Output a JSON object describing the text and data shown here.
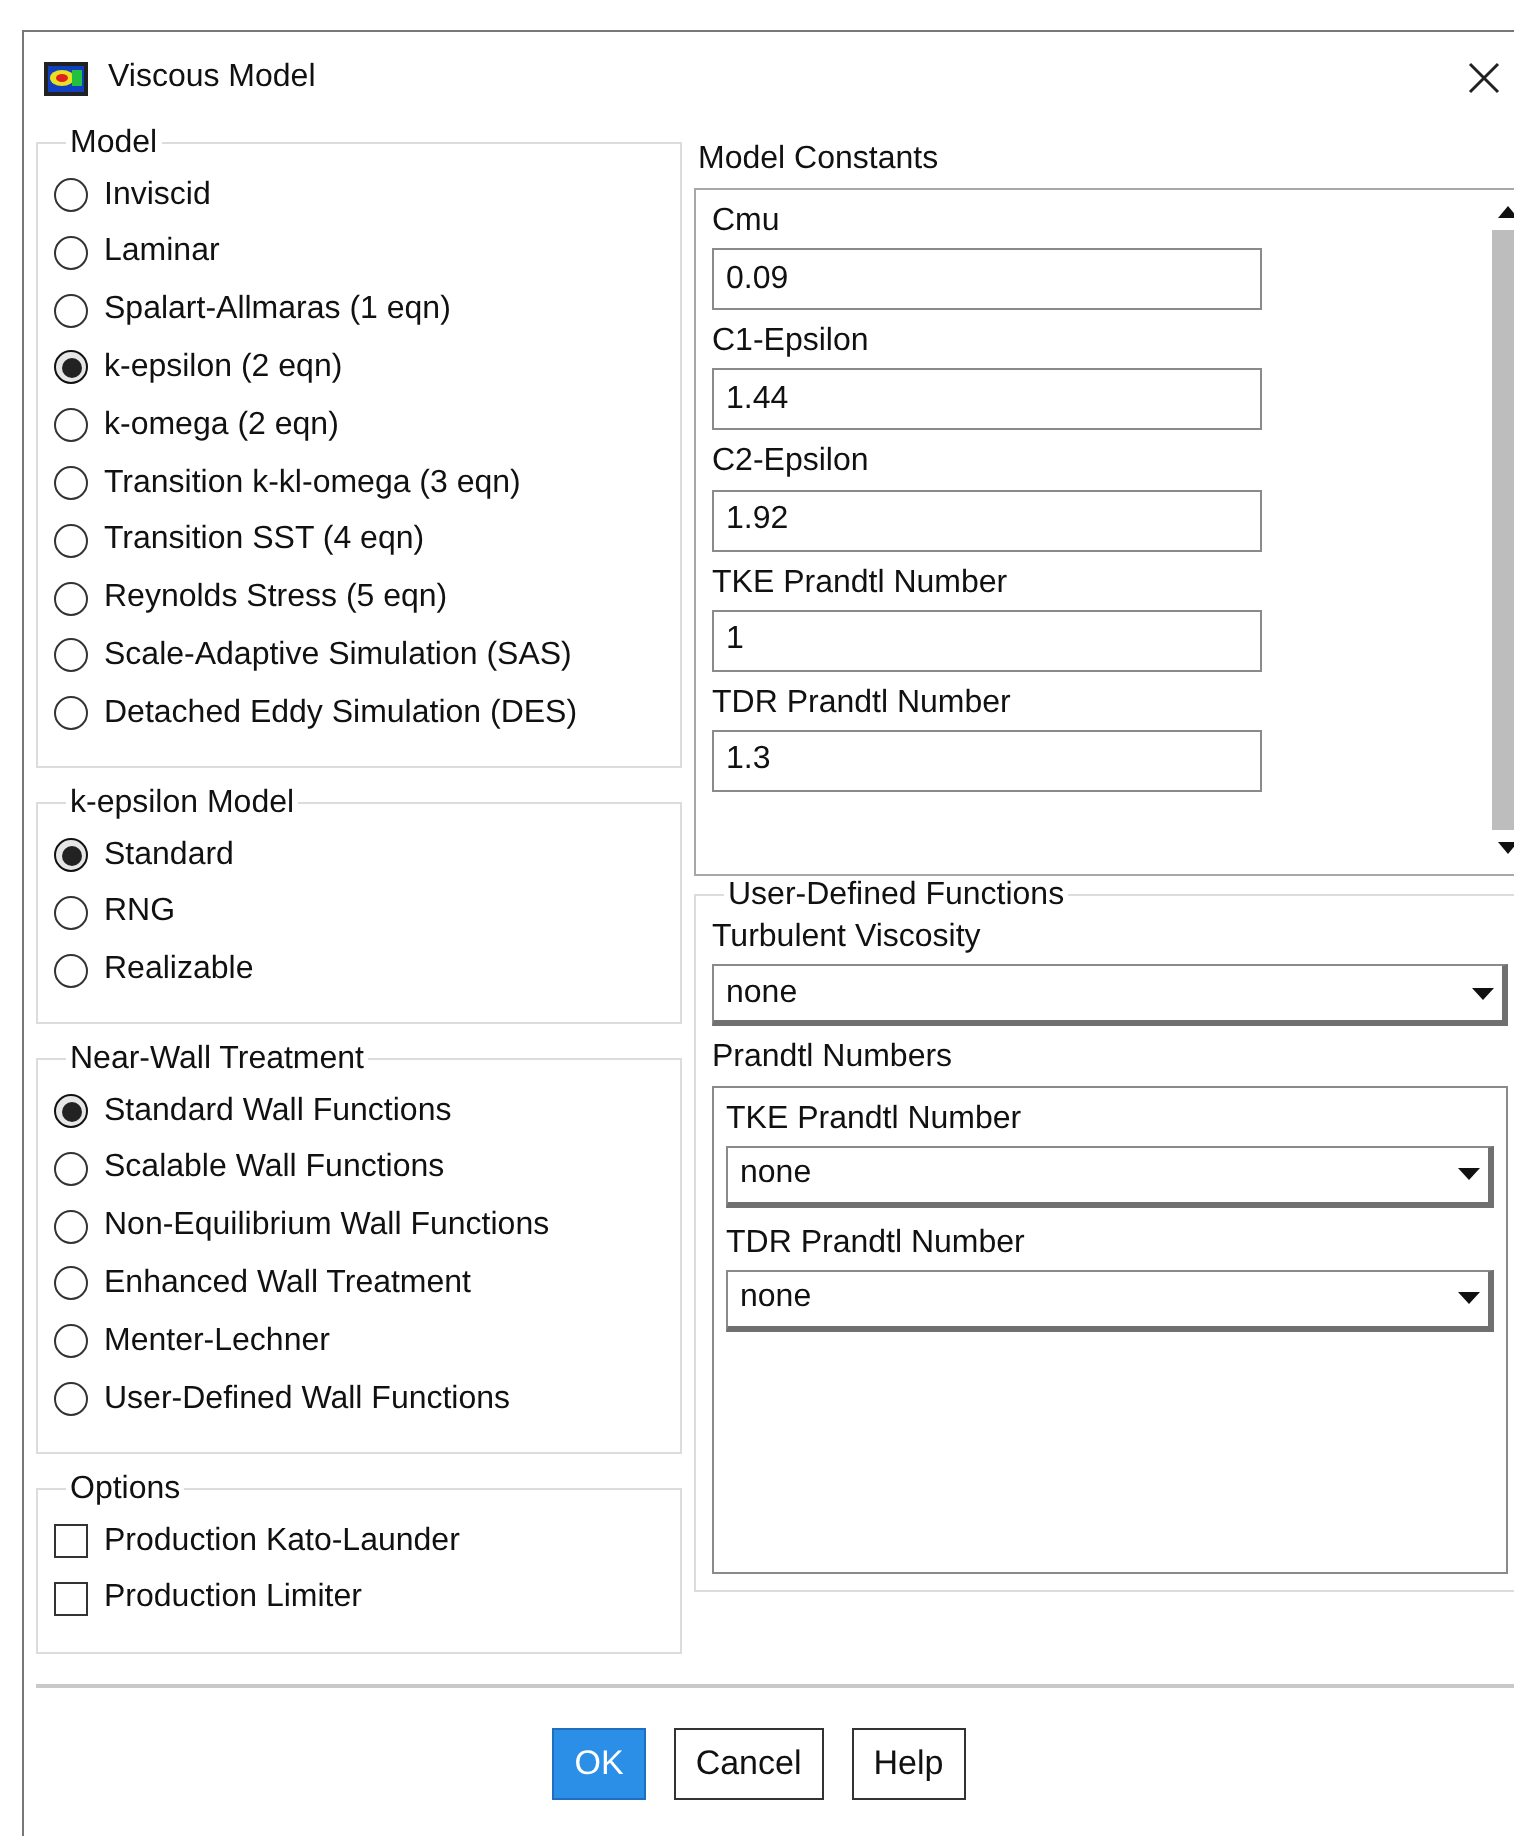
{
  "window": {
    "title": "Viscous Model"
  },
  "model": {
    "title": "Model",
    "options": [
      {
        "label": "Inviscid",
        "selected": false
      },
      {
        "label": "Laminar",
        "selected": false
      },
      {
        "label": "Spalart-Allmaras (1 eqn)",
        "selected": false
      },
      {
        "label": "k-epsilon (2 eqn)",
        "selected": true
      },
      {
        "label": "k-omega (2 eqn)",
        "selected": false
      },
      {
        "label": "Transition k-kl-omega (3 eqn)",
        "selected": false
      },
      {
        "label": "Transition SST (4 eqn)",
        "selected": false
      },
      {
        "label": "Reynolds Stress (5 eqn)",
        "selected": false
      },
      {
        "label": "Scale-Adaptive Simulation (SAS)",
        "selected": false
      },
      {
        "label": "Detached Eddy Simulation (DES)",
        "selected": false
      }
    ]
  },
  "k_epsilon_model": {
    "title": "k-epsilon Model",
    "options": [
      {
        "label": "Standard",
        "selected": true
      },
      {
        "label": "RNG",
        "selected": false
      },
      {
        "label": "Realizable",
        "selected": false
      }
    ]
  },
  "near_wall_treatment": {
    "title": "Near-Wall Treatment",
    "options": [
      {
        "label": "Standard Wall Functions",
        "selected": true
      },
      {
        "label": "Scalable Wall Functions",
        "selected": false
      },
      {
        "label": "Non-Equilibrium Wall Functions",
        "selected": false
      },
      {
        "label": "Enhanced Wall Treatment",
        "selected": false
      },
      {
        "label": "Menter-Lechner",
        "selected": false
      },
      {
        "label": "User-Defined Wall Functions",
        "selected": false
      }
    ]
  },
  "options": {
    "title": "Options",
    "items": [
      {
        "label": "Production Kato-Launder",
        "checked": false
      },
      {
        "label": "Production Limiter",
        "checked": false
      }
    ]
  },
  "model_constants": {
    "title": "Model Constants",
    "fields": [
      {
        "label": "Cmu",
        "value": "0.09"
      },
      {
        "label": "C1-Epsilon",
        "value": "1.44"
      },
      {
        "label": "C2-Epsilon",
        "value": "1.92"
      },
      {
        "label": "TKE Prandtl Number",
        "value": "1"
      },
      {
        "label": "TDR Prandtl Number",
        "value": "1.3"
      }
    ]
  },
  "user_defined_functions": {
    "title": "User-Defined Functions",
    "turbulent_viscosity": {
      "label": "Turbulent Viscosity",
      "value": "none"
    },
    "prandtl_numbers": {
      "title": "Prandtl Numbers",
      "fields": [
        {
          "label": "TKE Prandtl Number",
          "value": "none"
        },
        {
          "label": "TDR Prandtl Number",
          "value": "none"
        }
      ]
    }
  },
  "buttons": [
    {
      "label": "OK",
      "kind": "primary"
    },
    {
      "label": "Cancel",
      "kind": "default"
    },
    {
      "label": "Help",
      "kind": "default"
    }
  ]
}
